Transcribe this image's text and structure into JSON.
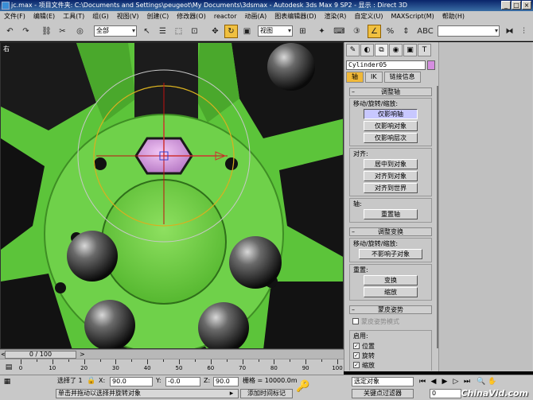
{
  "titlebar": {
    "title": "jc.max   - 项目文件夹: C:\\Documents and Settings\\peugeot\\My Documents\\3dsmax   - Autodesk 3ds Max 9 SP2   - 显示 : Direct 3D"
  },
  "menubar": {
    "items": [
      "文件(F)",
      "编辑(E)",
      "工具(T)",
      "组(G)",
      "视图(V)",
      "创建(C)",
      "修改器(O)",
      "reactor",
      "动画(A)",
      "图表编辑器(D)",
      "渲染(R)",
      "自定义(U)",
      "MAXScript(M)",
      "帮助(H)"
    ]
  },
  "toolbar": {
    "selection_filter": "全部",
    "ref_coord": "视图"
  },
  "viewport": {
    "label": "右"
  },
  "cmdpanel": {
    "object_name": "Cylinder05",
    "object_color": "#d58ee0",
    "subtabs": [
      "轴",
      "IK",
      "链接信息"
    ],
    "rollout_adjust_pivot": "调整轴",
    "group_move_rotate_scale": "移动/旋转/缩放:",
    "btn_affect_pivot": "仅影响轴",
    "btn_affect_object": "仅影响对象",
    "btn_affect_hierarchy": "仅影响层次",
    "group_align": "对齐:",
    "btn_center_to_object": "居中到对象",
    "btn_align_to_object": "对齐到对象",
    "btn_align_to_world": "对齐到世界",
    "group_pivot": "轴:",
    "btn_reset_pivot": "重置轴",
    "rollout_adjust_transform": "调整变换",
    "group_mrs2": "移动/旋转/缩放:",
    "btn_dont_affect_children": "不影响子对象",
    "group_reset": "重置:",
    "btn_transform": "变换",
    "btn_scale": "缩放",
    "rollout_skin_pose": "蒙皮姿势",
    "chk_skin_pose_mode": "蒙皮姿势模式",
    "group_enable": "启用:",
    "chk_position": "位置",
    "chk_rotation": "旋转",
    "chk_scale": "缩放"
  },
  "timeslider": {
    "label": "0 / 100"
  },
  "trackbar": {
    "ticks": [
      "0",
      "10",
      "20",
      "30",
      "40",
      "50",
      "60",
      "70",
      "80",
      "90",
      "100"
    ]
  },
  "statusbar": {
    "selection": "选择了 1",
    "x_label": "X:",
    "x_value": "90.0",
    "y_label": "Y:",
    "y_value": "-0.0",
    "z_label": "Z:",
    "z_value": "90.0",
    "grid": "栅格 = 10000.0m",
    "prompt": "单击并拖动以选择并旋转对象",
    "add_time_tag": "添加时间标记",
    "key_mode": "选定对象",
    "key_filters": "关键点过滤器",
    "frame": "0",
    "watermark": "ChinaVid.com"
  }
}
